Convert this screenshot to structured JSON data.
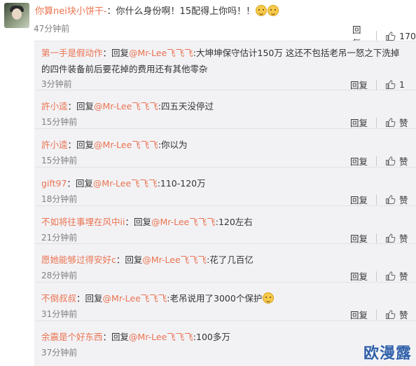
{
  "top_comment": {
    "username": "你算nei块小饼干-",
    "text": "：你什么身份啊！15配得上你吗！！",
    "time": "47分钟前",
    "reply_label": "回复",
    "likes": "170"
  },
  "replies": [
    {
      "username": "第一手是假动作",
      "prefix": "：回复",
      "mention": "@Mr-Lee飞飞飞",
      "text": ":大坤坤保守估计150万  这还不包括老吊一怒之下洗掉",
      "text2": "的四件装备前后要花掉的费用还有其他零杂",
      "time": "3分钟前",
      "reply_label": "回复",
      "likes": "1"
    },
    {
      "username": "許小逵",
      "prefix": "：回复",
      "mention": "@Mr-Lee飞飞飞",
      "text": ":四五天没停过",
      "time": "15分钟前",
      "reply_label": "回复",
      "likes": "赞"
    },
    {
      "username": "許小逵",
      "prefix": "：回复",
      "mention": "@Mr-Lee飞飞飞",
      "text": ":你以为",
      "time": "15分钟前",
      "reply_label": "回复",
      "likes": "赞"
    },
    {
      "username": "gift97",
      "prefix": "：回复",
      "mention": "@Mr-Lee飞飞飞",
      "text": ":110-120万",
      "time": "18分钟前",
      "reply_label": "回复",
      "likes": "赞"
    },
    {
      "username": "不如将往事埋在风中ii",
      "prefix": "：回复",
      "mention": "@Mr-Lee飞飞飞",
      "text": ":120左右",
      "time": "21分钟前",
      "reply_label": "回复",
      "likes": "赞"
    },
    {
      "username": "愿她能够过得安好c",
      "prefix": "：回复",
      "mention": "@Mr-Lee飞飞飞",
      "text": ":花了几百亿",
      "time": "28分钟前",
      "reply_label": "回复",
      "likes": "赞"
    },
    {
      "username": "不倒叔叔",
      "prefix": "：回复",
      "mention": "@Mr-Lee飞飞飞",
      "text": ":老吊说用了3000个保护",
      "time": "31分钟前",
      "reply_label": "回复",
      "likes": "赞"
    },
    {
      "username": "余震是个好东西",
      "prefix": "：回复",
      "mention": "@Mr-Lee飞飞飞",
      "text": ":100多万",
      "time": "37分钟前",
      "reply_label": "回复",
      "likes": "赞"
    }
  ],
  "watermark": "欧漫露",
  "colors": {
    "username": "#eb7350",
    "reply_bg": "#f2f2f5",
    "watermark": "#2f5fa8"
  }
}
